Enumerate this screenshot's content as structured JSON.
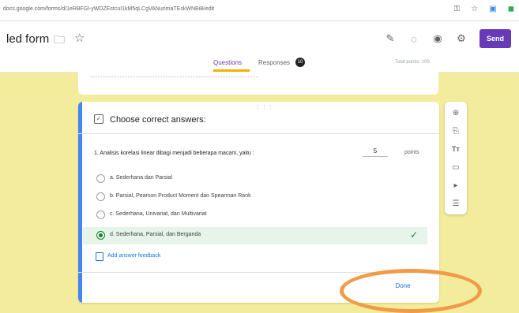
{
  "browser": {
    "url": "docs.google.com/forms/d/1eRBFGl-yWDZEstcuI1kM5qLCgVANunmaTEskWNBiB/edit",
    "icons": [
      "key-icon",
      "star-icon",
      "extensions-icon",
      "profile-icon"
    ]
  },
  "app": {
    "title": "led form",
    "send_label": "Send",
    "toolbar_icons": [
      "palette-icon",
      "preview-icon",
      "eye-icon",
      "settings-icon"
    ]
  },
  "tabs": {
    "questions": "Questions",
    "responses": "Responses",
    "responses_count": "10",
    "total_points": "Total points: 100"
  },
  "card": {
    "header": "Choose correct answers:",
    "question": "1. Analisis korelasi linear dibagi menjadi beberapa macam, yaitu :",
    "points_value": "5",
    "points_label": "points",
    "options": [
      {
        "label": "a. Sederhana dan Parsial",
        "correct": false
      },
      {
        "label": "b. Parsial, Pearson Product Moment dan Spearman Rank",
        "correct": false
      },
      {
        "label": "c. Sederhana, Univariat, dan Multivariat",
        "correct": false
      },
      {
        "label": "d. Sederhana, Parsial, dan Berganda",
        "correct": true
      }
    ],
    "feedback_link": "Add answer feedback",
    "done_label": "Done"
  },
  "side_toolbar": [
    "add-question-icon",
    "import-questions-icon",
    "add-title-icon",
    "add-image-icon",
    "add-video-icon",
    "add-section-icon"
  ],
  "colors": {
    "accent": "#673ab7",
    "background": "#f3ec9d",
    "card_accent": "#4285f4",
    "correct": "#188038",
    "annotation": "#f19a48"
  }
}
